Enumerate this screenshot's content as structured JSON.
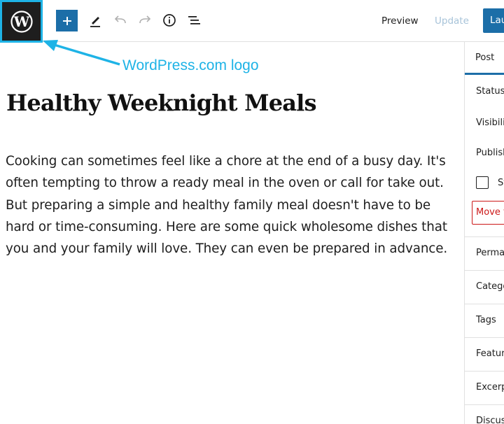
{
  "toolbar": {
    "logo_icon": "wordpress-logo-icon",
    "add_icon": "plus-icon",
    "tools_icon": "pencil-icon",
    "undo_icon": "undo-icon",
    "redo_icon": "redo-icon",
    "info_icon": "info-icon",
    "outline_icon": "list-view-icon",
    "preview_label": "Preview",
    "update_label": "Update",
    "launch_label": "Lau",
    "colors": {
      "primary": "#1c6ea8",
      "highlight": "#1eb3e6",
      "disabled_text": "#a7c3d9"
    }
  },
  "annotation": {
    "label": "WordPress.com logo",
    "color": "#1eb3e6"
  },
  "editor": {
    "title": "Healthy Weeknight Meals",
    "body": "Cooking can sometimes feel like a chore at the end of a busy day. It's often tempting to throw a ready meal in the oven or call for take out. But preparing a simple and healthy family meal doesn't have to be hard or time-consuming. Here are some quick wholesome dishes that you and your family will love. They can even be prepared in advance."
  },
  "sidebar": {
    "tab_label": "Post",
    "status_heading": "Status",
    "visibility_label": "Visibilit",
    "publish_label": "Publish",
    "sticky_label": "St",
    "trash_label": "Move to",
    "panels": [
      "Permal",
      "Catego",
      "Tags",
      "Feature",
      "Excerp",
      "Discus"
    ]
  }
}
